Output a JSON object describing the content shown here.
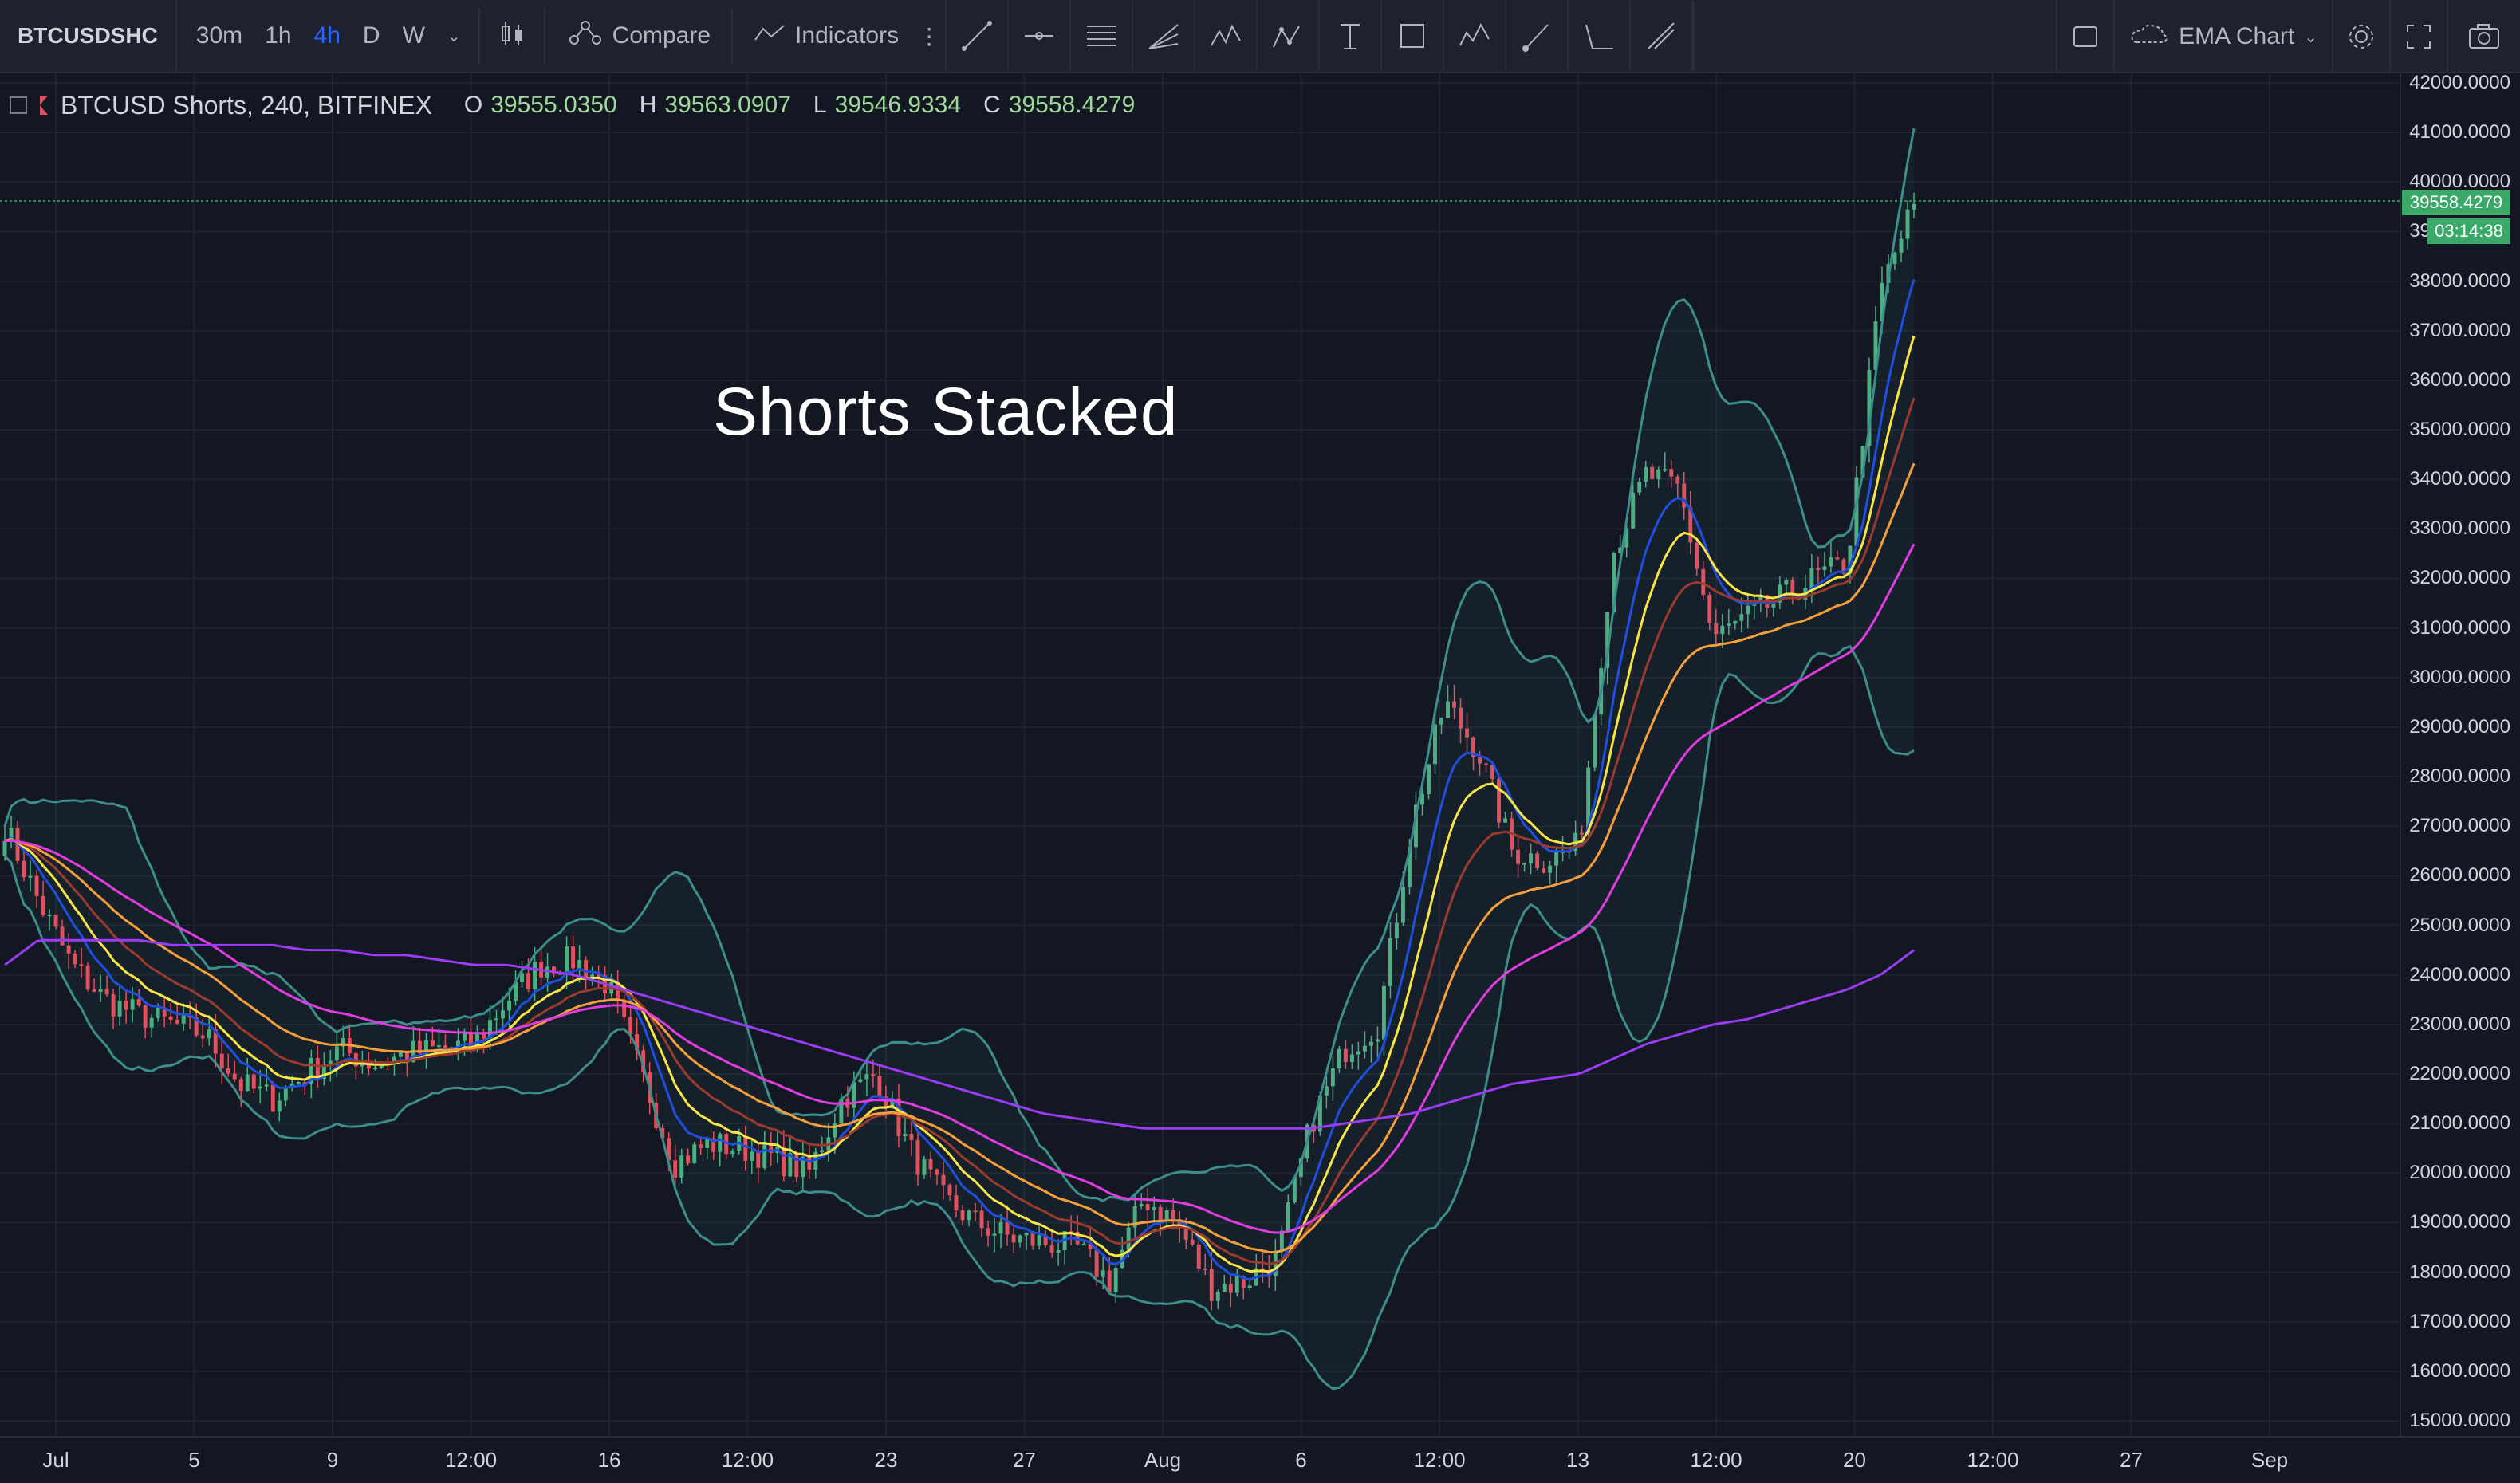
{
  "toolbar": {
    "symbol": "BTCUSDSHC",
    "intervals": [
      "30m",
      "1h",
      "4h",
      "D",
      "W"
    ],
    "active_interval": "4h",
    "compare_label": "Compare",
    "indicators_label": "Indicators",
    "layout_label": "EMA Chart"
  },
  "legend": {
    "title": "BTCUSD Shorts, 240, BITFINEX",
    "open_key": "O",
    "open": "39555.0350",
    "high_key": "H",
    "high": "39563.0907",
    "low_key": "L",
    "low": "39546.9334",
    "close_key": "C",
    "close": "39558.4279"
  },
  "annotation": "Shorts Stacked",
  "price_tag": "39558.4279",
  "timer_tag": "03:14:38",
  "colors": {
    "background": "#131722",
    "up": "#4caf82",
    "down": "#e0505d",
    "bb": "#3c8e8b",
    "ema_blue": "#1f4fe0",
    "ema_yellow": "#f7e546",
    "ema_brown": "#9b3a2e",
    "ema_orange": "#f59f3a",
    "ema_pink": "#e03ce0",
    "ema_purple": "#9a3cf5"
  },
  "chart_data": {
    "type": "line",
    "ylim": [
      15000,
      42000
    ],
    "y_ticks": [
      "42000.0000",
      "41000.0000",
      "40000.0000",
      "39000.0000",
      "38000.0000",
      "37000.0000",
      "36000.0000",
      "35000.0000",
      "34000.0000",
      "33000.0000",
      "32000.0000",
      "31000.0000",
      "30000.0000",
      "29000.0000",
      "28000.0000",
      "27000.0000",
      "26000.0000",
      "25000.0000",
      "24000.0000",
      "23000.0000",
      "22000.0000",
      "21000.0000",
      "20000.0000",
      "19000.0000",
      "18000.0000",
      "17000.0000",
      "16000.0000",
      "15000.0000"
    ],
    "x_ticks": [
      "Jul",
      "5",
      "9",
      "12:00",
      "16",
      "12:00",
      "23",
      "27",
      "Aug",
      "6",
      "12:00",
      "13",
      "12:00",
      "20",
      "12:00",
      "27",
      "Sep"
    ],
    "price_series": {
      "name": "BTCUSD Shorts",
      "values": [
        27000,
        25500,
        24200,
        23500,
        23200,
        23000,
        22800,
        21800,
        21500,
        22000,
        22500,
        22200,
        22400,
        22500,
        22600,
        23500,
        24200,
        24300,
        23800,
        22000,
        20200,
        20600,
        20500,
        20300,
        20000,
        21500,
        22000,
        20500,
        19500,
        19000,
        18700,
        18600,
        18500,
        17800,
        19500,
        19000,
        17700,
        17800,
        18300,
        21000,
        22500,
        23000,
        27000,
        29500,
        28500,
        26500,
        26300,
        26600,
        32500,
        34100,
        33800,
        30800,
        31200,
        31600,
        32000,
        32300,
        37800,
        39558
      ]
    },
    "ema_fast": [
      25000,
      24500,
      23800,
      23300,
      23000,
      22800,
      22500,
      22000,
      21800,
      21900,
      22100,
      22200,
      22300,
      22400,
      22500,
      23000,
      23600,
      23900,
      23500,
      22500,
      21200,
      20800,
      20600,
      20400,
      20200,
      20800,
      21200,
      20900,
      20200,
      19600,
      19200,
      18900,
      18700,
      18400,
      18700,
      18900,
      18400,
      18200,
      18300,
      19600,
      21200,
      22300,
      24400,
      26600,
      27500,
      27000,
      26700,
      26700,
      28800,
      31500,
      32800,
      31900,
      31500,
      31600,
      31800,
      32000,
      34000,
      37800
    ],
    "ema_slow": [
      24200,
      24700,
      24700,
      24700,
      24700,
      24600,
      24600,
      24600,
      24600,
      24500,
      24500,
      24400,
      24400,
      24300,
      24200,
      24200,
      24100,
      24000,
      23800,
      23600,
      23400,
      23200,
      23000,
      22800,
      22600,
      22400,
      22200,
      22000,
      21800,
      21600,
      21400,
      21200,
      21100,
      21000,
      20900,
      20900,
      20900,
      20900,
      20900,
      20900,
      21000,
      21100,
      21200,
      21400,
      21600,
      21800,
      21900,
      22000,
      22300,
      22600,
      22800,
      23000,
      23100,
      23300,
      23500,
      23700,
      24000,
      24500
    ]
  }
}
